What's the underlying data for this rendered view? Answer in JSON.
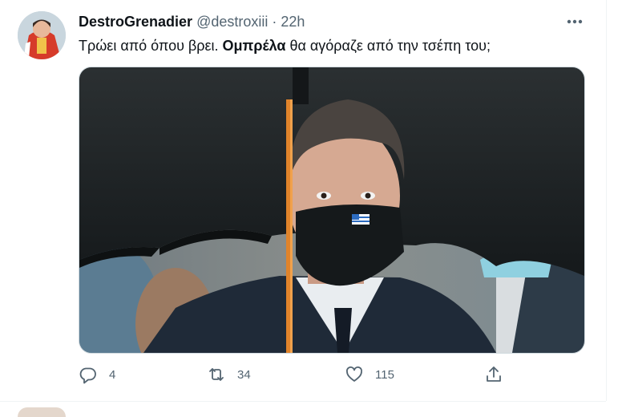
{
  "tweet": {
    "display_name": "DestroGrenadier",
    "handle": "@destroxiii",
    "separator": "·",
    "time": "22h",
    "text_part1": "Τρώει από όπου βρει. ",
    "text_bold": "Ομπρέλα",
    "text_part2": " θα αγόραζε από την τσέπη του;",
    "media_description_icon": "photo-icon"
  },
  "actions": {
    "reply_count": "4",
    "retweet_count": "34",
    "like_count": "115"
  },
  "colors": {
    "text_primary": "#0f1419",
    "text_secondary": "#536471",
    "border": "#cfd9de",
    "umbrella": "#1e2326",
    "umbrella_shaft": "#e0832a"
  }
}
